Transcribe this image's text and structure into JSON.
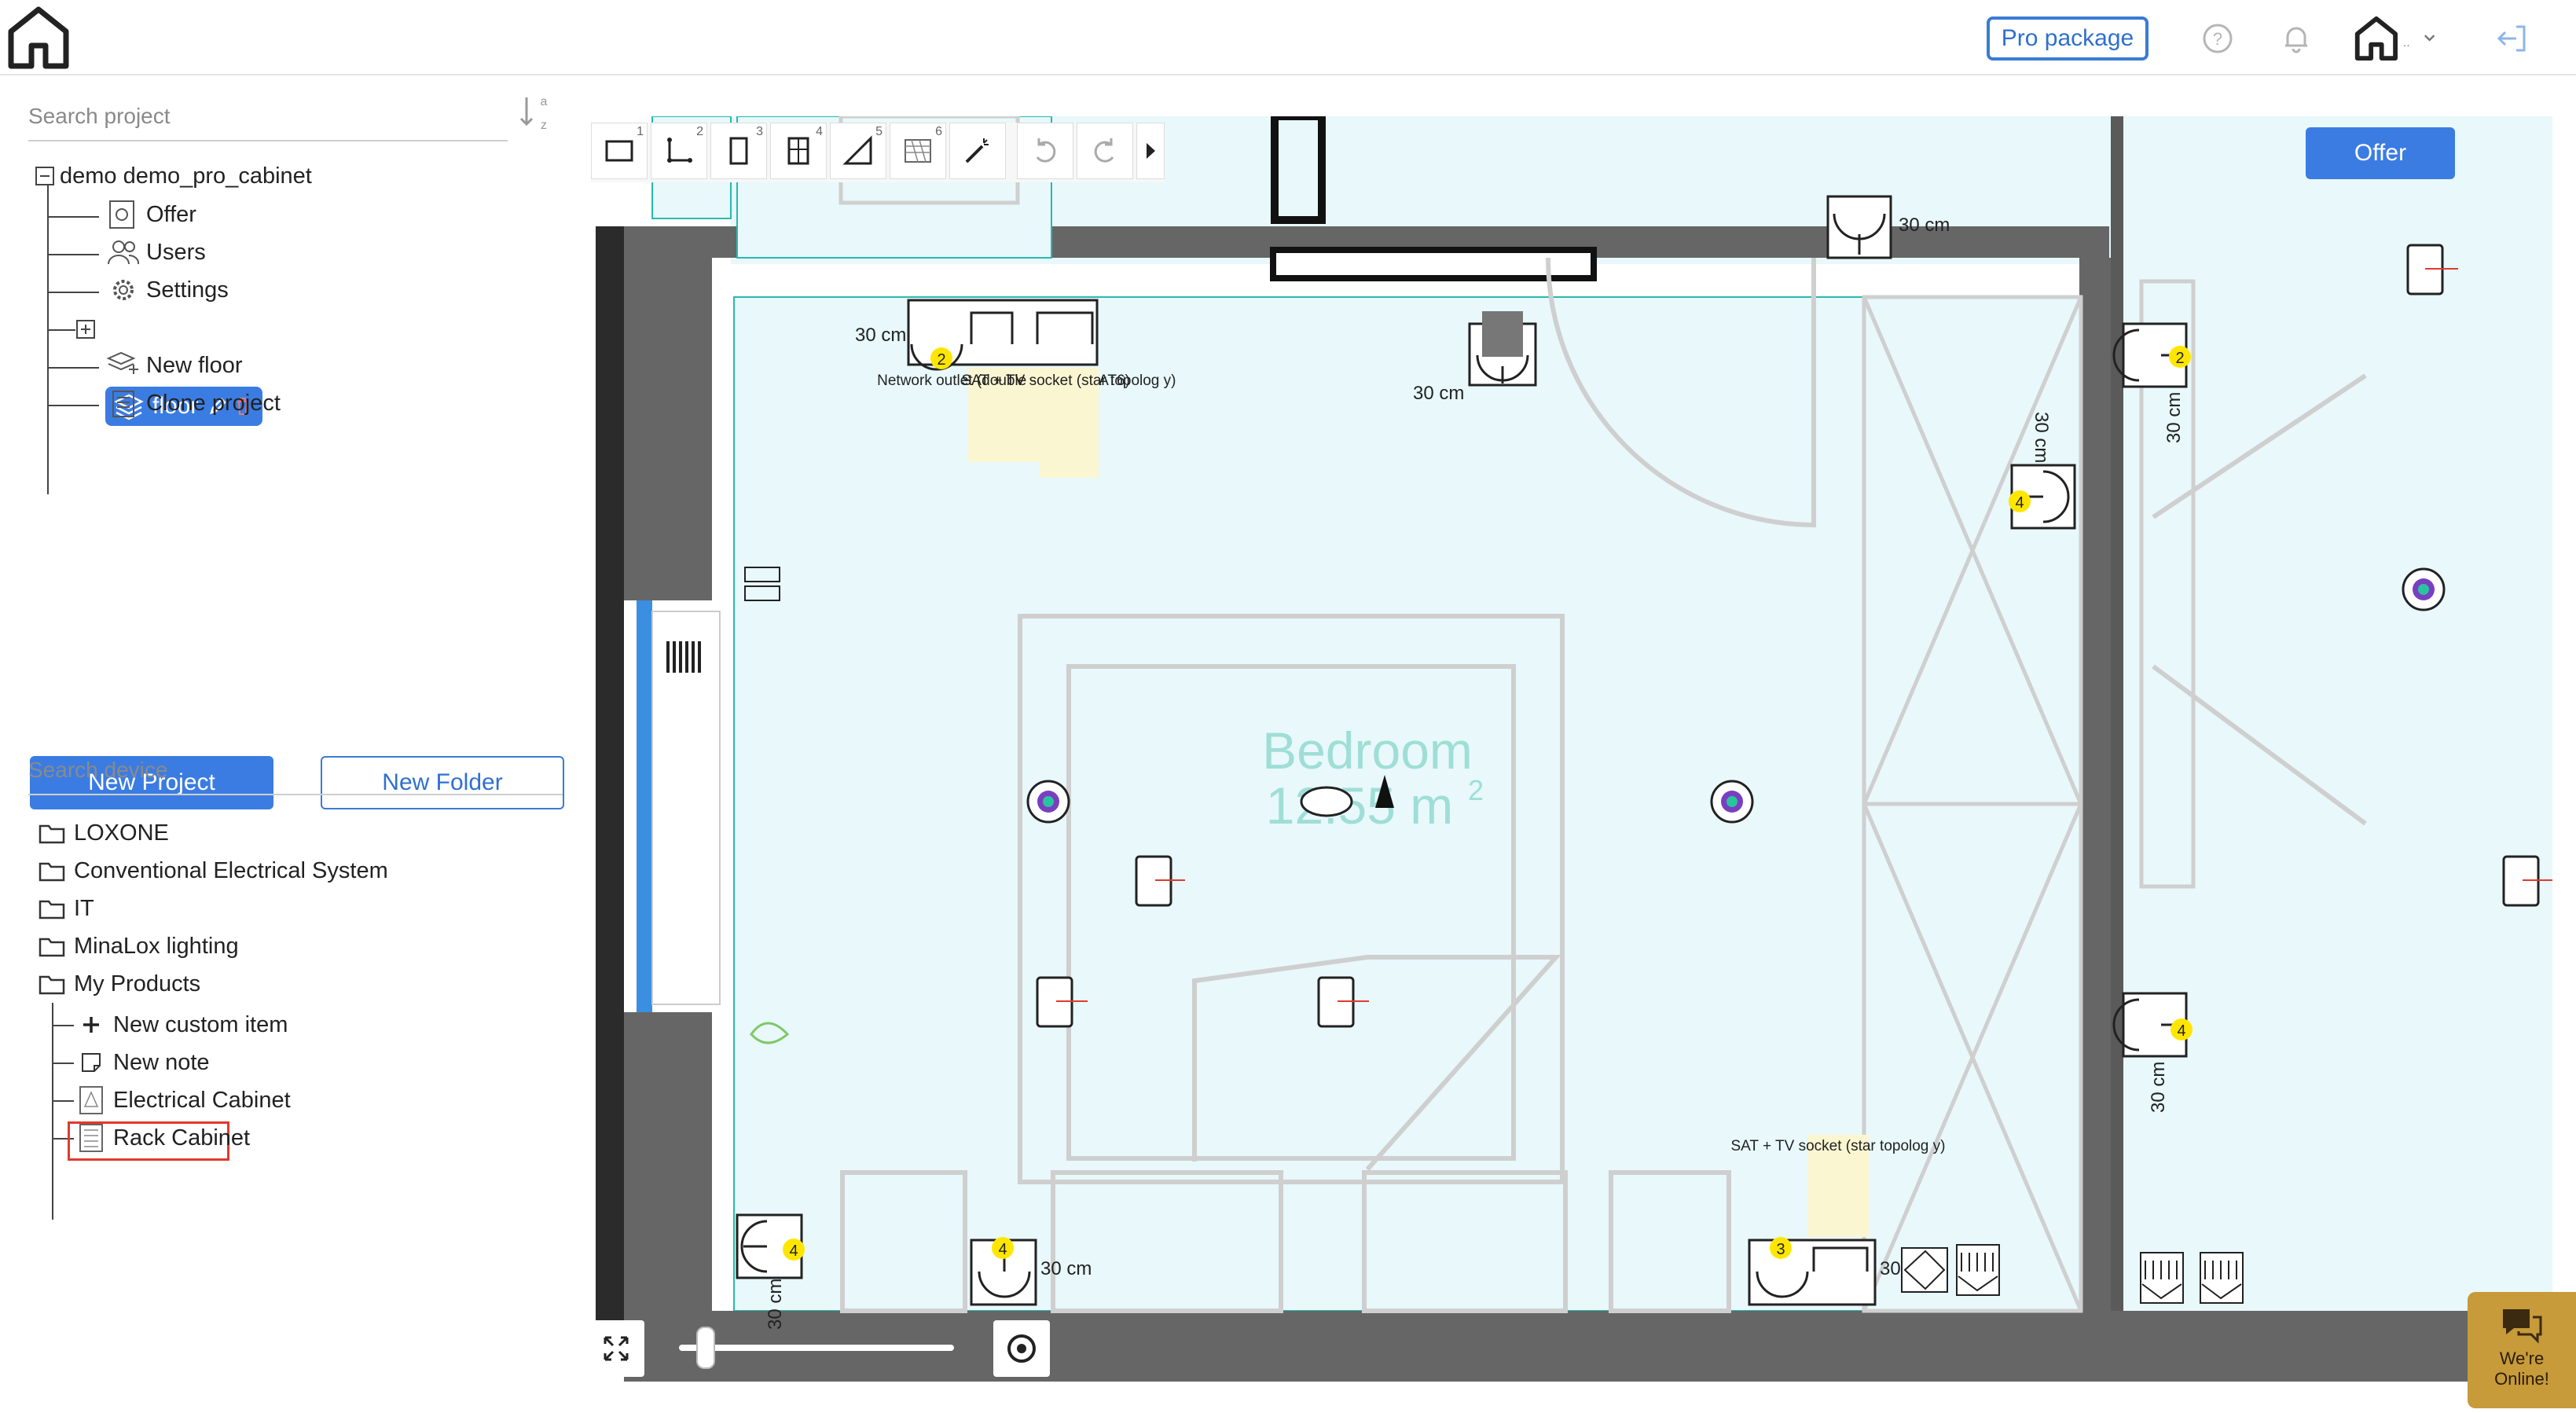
{
  "header": {
    "pro_package": "Pro package",
    "account_name": ".."
  },
  "project_panel": {
    "search_placeholder": "Search project",
    "sort_top": "a",
    "sort_bottom": "z",
    "root": "demo demo_pro_cabinet",
    "items": [
      "Offer",
      "Users",
      "Settings",
      "floor",
      "New floor",
      "Clone project"
    ]
  },
  "buttons": {
    "new_project": "New Project",
    "new_folder": "New Folder",
    "offer": "Offer"
  },
  "device_panel": {
    "search_placeholder": "Search device",
    "folders": [
      "LOXONE",
      "Conventional Electrical System",
      "IT",
      "MinaLox lighting",
      "My Products"
    ],
    "my_products_items": [
      "New custom item",
      "New note",
      "Electrical Cabinet",
      "Rack Cabinet"
    ]
  },
  "toolbar": {
    "nums": [
      "1",
      "2",
      "3",
      "4",
      "5",
      "6"
    ]
  },
  "floorplan": {
    "room_name": "Bedroom",
    "room_area": "12.55 m",
    "room_area_sup": "2",
    "dims": [
      "30 cm",
      "30 cm",
      "30 cm",
      "30 cm",
      "30 cm",
      "30 cm",
      "30 cm",
      "30 cm",
      "30 cm"
    ],
    "badges": [
      "2",
      "2",
      "4",
      "4",
      "4",
      "4",
      "3"
    ],
    "note_network": "Network outlet (double - RJ45 - CAT6)",
    "note_sat": "SAT + TV socket (star topolog y)",
    "note_sat2": "SAT + TV socket (star topolog y)"
  },
  "chat": {
    "line1": "We're",
    "line2": "Online!"
  },
  "colors": {
    "accent": "#3b7ce3",
    "room_fill": "#e8f8fb",
    "wall": "#6a6a6a",
    "highlight": "#e03a2f",
    "badge": "#ffe600"
  }
}
